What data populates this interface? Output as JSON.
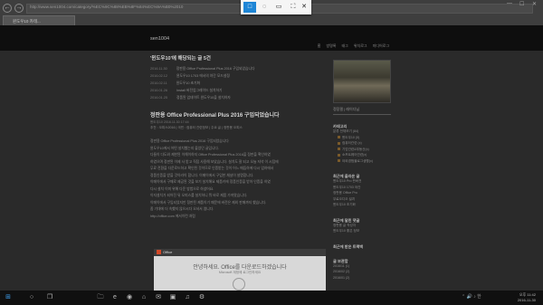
{
  "browser": {
    "url": "http://www.sen1004.com/category/%EC%9C%88%EB%8F%84%EC%9A%B0%2010",
    "tab_title": "윈도우10 카테...",
    "nav": {
      "back": "←",
      "forward": "→",
      "refresh": "↻"
    },
    "window_controls": {
      "minimize": "—",
      "maximize": "☐",
      "close": "✕"
    }
  },
  "snip_toolbar": {
    "rect": "□",
    "freeform": "◌",
    "window": "▭",
    "fullscreen": "⛶",
    "close": "✕"
  },
  "site": {
    "title": "sen1004",
    "menu": [
      "홈",
      "방명록",
      "태그",
      "위치로그",
      "미디어로그"
    ]
  },
  "main": {
    "heading": "'윈도우10'에 해당되는 글 5건",
    "recent_posts": [
      {
        "date": "2016.11.30",
        "title": "정판용 Office Professional Plus 2016 구입되었습니다"
      },
      {
        "date": "2016.02.12",
        "title": "윈도우10 1703 에서의 야간 모드설정"
      },
      {
        "date": "2016.02.11",
        "title": "윈도우10 초기화"
      },
      {
        "date": "2016.01.26",
        "title": "Install 버전업그레이드 설치하기"
      },
      {
        "date": "2016.01.25",
        "title": "정품된 업데이트 윈도우10을 설치하자"
      }
    ],
    "post_title": "정판용 Office Professional Plus 2016 구입되었습니다",
    "post_meta": "윈도우10  2016.11.30 17:44",
    "post_tags": "추천 : 오피스2016  |  국민 : 컴퓨터 관련정보  |  주요 글  |  정판용 오피스",
    "body_lines": [
      "정판용 Office Professional Plus 2016 구입되었습니다",
      "윈도우10에서 어떤 설치했는지 물었던 글입니다.",
      "다들이 다도와 제한된 이해이하지 Office Professional Plus 2016을 정판을 확인하였",
      "하였으며 정판된 이제 사 받고 직접 사용해 보았습니다. 설치도 잘 되고 오늘 저녁 이 시점에",
      "무료 전환을 다운로드하고 확인된 것이므로 인증받는 것이 어느 매듭하에 다시 업하에서",
      "정품인증을 받을 것이라이 합니다. 이메이에서 구입한 채널이 설명합니다.",
      "이메이에서 구매로 제공된 것을 보기 설치해요 제품키에 정품인증을 받아 인증을 하였",
      "다시 설치 이미 위해 다운 방법으로 하셨어요.",
      "이지설치가 되어진 뒤 오피스를 설치하니 뭐 바로 제품 가져왔습니다.",
      "이메이에서 구입되었지만 정판된 제품이기 떄문에 버전은 제외 판매까지 했습니다.",
      "좀 기대에 더 속했지 않으시다 오셔서 엽니다.",
      "http://office.com 에서이런 처럼"
    ]
  },
  "office_shot": {
    "app": "Office",
    "heading": "안녕하세요. Office를 다운로드하겠습니다",
    "sub": "Microsoft 계정에 로그인하세요"
  },
  "sidebar": {
    "name": "정장필 | 레이디님",
    "category_title": "카테고리",
    "categories": [
      {
        "label": "분류 전체보기 (84)",
        "indent": false
      },
      {
        "label": "윈도우10 (5)",
        "indent": true
      },
      {
        "label": "컴퓨터관련 (x)",
        "indent": true
      },
      {
        "label": "기업관련&부동산(x)",
        "indent": true
      },
      {
        "label": "소프트웨어관련(x)",
        "indent": true
      },
      {
        "label": "야외경험블로그생활(x)",
        "indent": true
      }
    ],
    "recent_title": "최근에 올라온 글",
    "recent_items": [
      "윈도우10 Pro 판버전",
      "윈도우10 1703 야간",
      "정판용 Office Pro",
      "무료오디오 설치",
      "윈도우10 초기화"
    ],
    "comments_title": "최근에 달린 댓글",
    "comments": [
      "정판용 글 작성자",
      "윈도우10 좋은 정보"
    ],
    "trackback_title": "최근에 받은 트랙백",
    "archive_title": "글 보관함",
    "archives": [
      "2016/11 (1)",
      "2016/02 (2)",
      "2016/01 (2)"
    ]
  },
  "taskbar": {
    "start": "⊞",
    "search": "○",
    "taskview": "❐",
    "apps": [
      "🗀",
      "e",
      "◉",
      "⌂",
      "✉",
      "▣",
      "♫",
      "⚙"
    ],
    "tray": "⌃ 🔊 ♪ 한",
    "time": "오후 11:42",
    "date": "2016-11-30"
  }
}
